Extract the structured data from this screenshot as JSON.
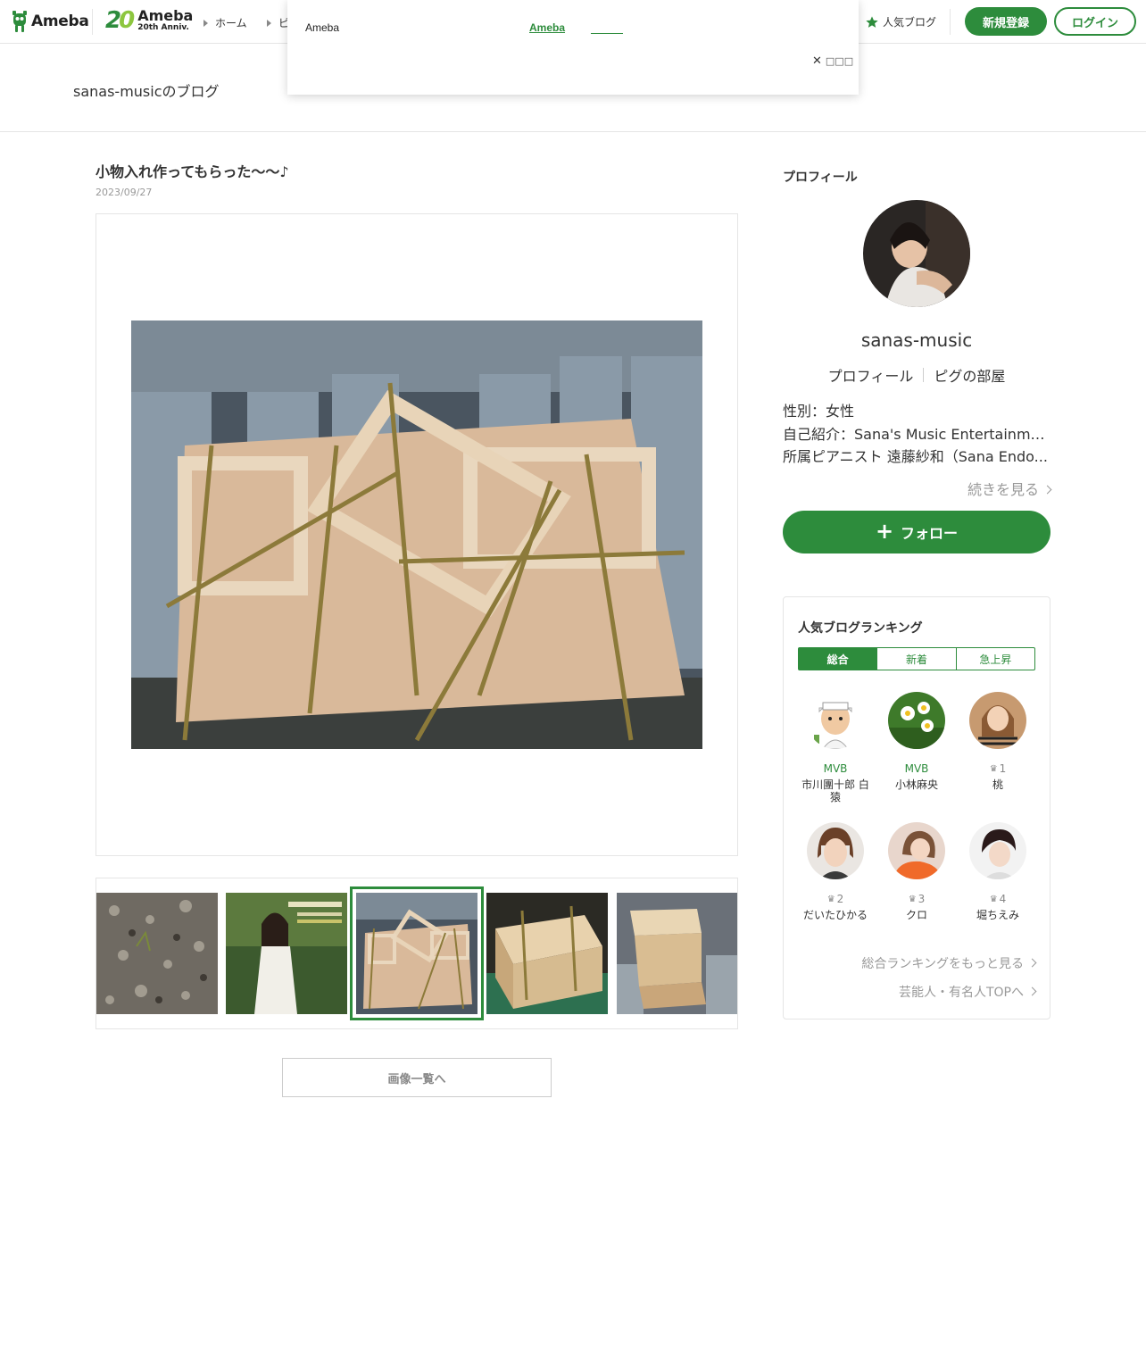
{
  "header": {
    "logo_text": "Ameba",
    "anniv_number": [
      "2",
      "0"
    ],
    "anniv_title": "Ameba",
    "anniv_sub": "20th Anniv.",
    "breadcrumb": [
      "ホーム",
      "ピ"
    ],
    "popular_blog_label": "人気ブログ",
    "register_label": "新規登録",
    "login_label": "ログイン"
  },
  "overlay": {
    "title": "Ameba",
    "link_label": "Ameba",
    "close_label": "□□□"
  },
  "blog": {
    "name": "sanas-musicのブログ"
  },
  "article": {
    "title": "小物入れ作ってもらった〜〜♪",
    "date": "2023/09/27",
    "image_list_button": "画像一覧へ"
  },
  "profile": {
    "heading": "プロフィール",
    "name": "sanas-music",
    "links": [
      "プロフィール",
      "ピグの部屋"
    ],
    "info": [
      "性別：女性",
      "自己紹介：Sana's Music Entertainment",
      "所属ピアニスト 遠藤紗和（Sana Endo..."
    ],
    "more_label": "続きを見る",
    "follow_label": "フォロー"
  },
  "ranking": {
    "title": "人気ブログランキング",
    "tabs": [
      "総合",
      "新着",
      "急上昇"
    ],
    "active_tab": "総合",
    "items": [
      {
        "label": "MVB",
        "name": "市川團十郎 白猿"
      },
      {
        "label": "MVB",
        "name": "小林麻央"
      },
      {
        "label": "1",
        "name": "桃"
      },
      {
        "label": "2",
        "name": "だいたひかる"
      },
      {
        "label": "3",
        "name": "クロ"
      },
      {
        "label": "4",
        "name": "堀ちえみ"
      }
    ],
    "more_label": "総合ランキングをもっと見る",
    "celeb_label": "芸能人・有名人TOPへ"
  },
  "colors": {
    "accent": "#2d8c3c",
    "border": "#e5e5e5",
    "muted": "#999999"
  }
}
